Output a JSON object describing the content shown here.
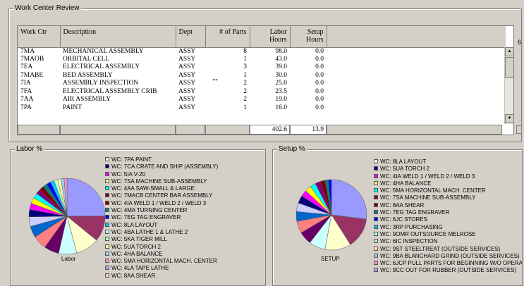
{
  "panel_title": "Work Center Review",
  "grid": {
    "headers": [
      "Work Ctr",
      "Description",
      "Dept",
      "# of Parts",
      "Labor\nHours",
      "Setup\nHours"
    ],
    "header_labor": [
      "Labor",
      "Hours"
    ],
    "header_setup": [
      "Setup",
      "Hours"
    ],
    "rows": [
      [
        "7MA",
        "MECHANICAL ASSEMBLY",
        "ASSY",
        "8",
        "98.0",
        "0.0"
      ],
      [
        "7MAOB",
        "ORBITAL CELL",
        "ASSY",
        "1",
        "43.0",
        "0.0"
      ],
      [
        "7EA",
        "ELECTRICAL ASSEMBLY",
        "ASSY",
        "3",
        "39.0",
        "0.0"
      ],
      [
        "7MABE",
        "BED ASSEMBLY",
        "ASSY",
        "1",
        "30.0",
        "0.0"
      ],
      [
        "7IA",
        "ASSEMBLY INSPECTION",
        "ASSY",
        "2",
        "25.0",
        "0.0"
      ],
      [
        "7FA",
        "ELECTRICAL ASSEMBLY CRIB",
        "ASSY",
        "2",
        "23.5",
        "0.0"
      ],
      [
        "7AA",
        "AIR ASSEMBLY",
        "ASSY",
        "2",
        "19.0",
        "0.0"
      ],
      [
        "7PA",
        "PAINT",
        "ASSY",
        "1",
        "16.0",
        "0.0"
      ]
    ],
    "total_labor": "402.6",
    "total_setup": "13.9",
    "resize_cursor": "↔"
  },
  "labor_chart": {
    "title": "Labor %",
    "pie_label": "Labor",
    "legend": [
      {
        "text": "WC: 7PA   PAINT",
        "color": "#ffffff"
      },
      {
        "text": "WC: 7CA   CRATE AND SHIP (ASSEMBLY)",
        "color": "#000080"
      },
      {
        "text": "WC: 5IA   V-20",
        "color": "#ff00ff"
      },
      {
        "text": "WC: 7SA   MACHINE SUB-ASSEMBLY",
        "color": "#ffff80"
      },
      {
        "text": "WC: 4AA   SAW-SMALL & LARGE",
        "color": "#00ffff"
      },
      {
        "text": "WC: 7MACB   CENTER BAR ASSEMBLY",
        "color": "#800040"
      },
      {
        "text": "WC: 4IA   WELD 1 / WELD 2 / WELD 3",
        "color": "#800000"
      },
      {
        "text": "WC: 4MA   TURNING CENTER",
        "color": "#008080"
      },
      {
        "text": "WC: 7EG   TAG ENGRAVER",
        "color": "#0000ff"
      },
      {
        "text": "WC: 8LA   LAYOUT",
        "color": "#00c0ff"
      },
      {
        "text": "WC: 4BA   LATHE 1 & LATHE 2",
        "color": "#c0ffff"
      },
      {
        "text": "WC: 5KA   TIGER MILL",
        "color": "#c0ffc0"
      },
      {
        "text": "WC: 5UA   TORCH 2",
        "color": "#ffff99"
      },
      {
        "text": "WC: 4HA   BALANCE",
        "color": "#99ccff"
      },
      {
        "text": "WC: 5MA   HORIZONTAL MACH. CENTER",
        "color": "#ff99cc"
      },
      {
        "text": "WC: 4LA   TAPE LATHE",
        "color": "#cc99ff"
      },
      {
        "text": "WC: 8AA   SHEAR",
        "color": "#ffcc99"
      }
    ]
  },
  "setup_chart": {
    "title": "Setup %",
    "pie_label": "SETUP",
    "legend": [
      {
        "text": "WC: 8LA   LAYOUT",
        "color": "#ffffff"
      },
      {
        "text": "WC: 5UA   TORCH 2",
        "color": "#000080"
      },
      {
        "text": "WC: 4IA   WELD 1 / WELD 2 / WELD 3",
        "color": "#ff00ff"
      },
      {
        "text": "WC: 4HA   BALANCE",
        "color": "#ffff80"
      },
      {
        "text": "WC: 5MA   HORIZONTAL MACH. CENTER",
        "color": "#00ffff"
      },
      {
        "text": "WC: 7SA   MACHINE SUB-ASSEMBLY",
        "color": "#800040"
      },
      {
        "text": "WC: 8AA   SHEAR",
        "color": "#800000"
      },
      {
        "text": "WC: 7EG   TAG ENGRAVER",
        "color": "#008080"
      },
      {
        "text": "WC: 6JC   STORES",
        "color": "#0000ff"
      },
      {
        "text": "WC: 3RP   PURCHASING",
        "color": "#00c0ff"
      },
      {
        "text": "WC: 9OMR   OUTSOURCE MELROSE",
        "color": "#c0ffff"
      },
      {
        "text": "WC: 6IC   INSPECTION",
        "color": "#c0ffc0"
      },
      {
        "text": "WC: 9ST   STEELTREAT (OUTSIDE SERVICES)",
        "color": "#ffff99"
      },
      {
        "text": "WC: 9BA   BLANCHARD GRIND (OUTSIDE SERVICES)",
        "color": "#99ccff"
      },
      {
        "text": "WC: 6JCP   PULL PARTS FOR BEGINNING W/O OPERATION",
        "color": "#ff99cc"
      },
      {
        "text": "WC: 9CC   OUT FOR RUBBER (OUTSIDE SERVICES)",
        "color": "#cc99ff"
      }
    ]
  },
  "pie_labor": {
    "colors": [
      "#9999ff",
      "#993366",
      "#ffffcc",
      "#ccffff",
      "#660066",
      "#ff8080",
      "#0066cc",
      "#ccccff",
      "#000080",
      "#ff00ff",
      "#ffff00",
      "#00ffff",
      "#800080",
      "#800000",
      "#008080",
      "#0000ff",
      "#00ccff",
      "#ccffcc",
      "#ffff99",
      "#99ccff",
      "#ff99cc"
    ],
    "values": [
      24.3,
      10.7,
      9.7,
      7.5,
      6.2,
      5.8,
      4.7,
      4.0,
      3.0,
      2.6,
      2.4,
      2.2,
      2.0,
      1.9,
      1.8,
      1.7,
      1.6,
      1.5,
      1.4,
      1.3,
      1.2
    ]
  },
  "pie_setup": {
    "colors": [
      "#9999ff",
      "#993366",
      "#ffffcc",
      "#ccffff",
      "#660066",
      "#ff8080",
      "#0066cc",
      "#ccccff",
      "#000080",
      "#ff00ff",
      "#ffff00",
      "#00ffff",
      "#800080",
      "#800000",
      "#008080",
      "#0000ff"
    ],
    "values": [
      27.0,
      14.0,
      12.0,
      7.5,
      6.0,
      5.5,
      4.5,
      4.0,
      3.5,
      3.0,
      2.8,
      2.6,
      2.4,
      2.2,
      1.6,
      1.4
    ]
  },
  "right_edge_glyph": "6"
}
